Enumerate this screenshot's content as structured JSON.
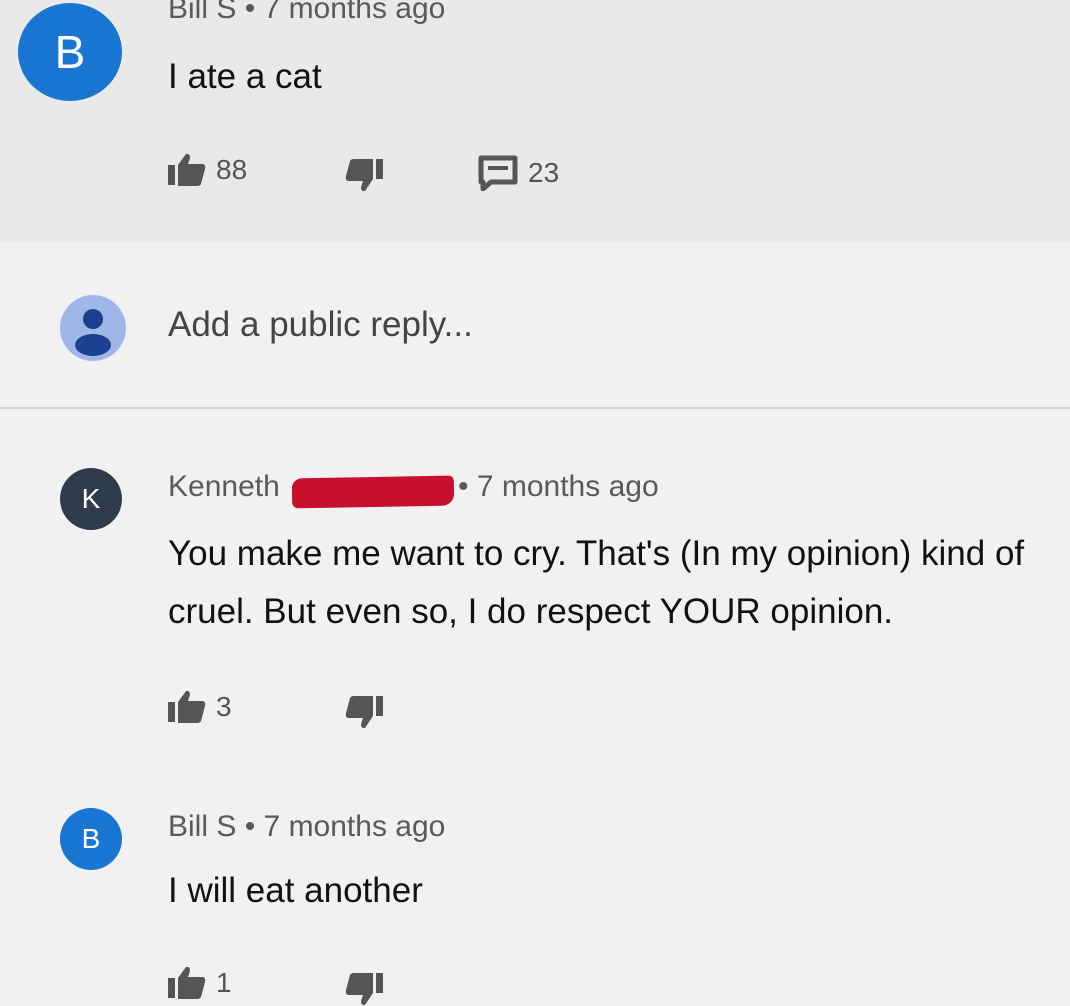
{
  "comments": [
    {
      "avatar_letter": "B",
      "author": "Bill S",
      "time": "7 months ago",
      "text": "I ate a cat",
      "likes": "88",
      "replies": "23"
    },
    {
      "avatar_letter": "K",
      "author": "Kenneth",
      "time": "7 months ago",
      "text": "You make me want to cry. That's (In my opinion) kind of cruel. But even so, I do respect YOUR opinion.",
      "likes": "3"
    },
    {
      "avatar_letter": "B",
      "author": "Bill S",
      "time": "7 months ago",
      "text": "I will eat another",
      "likes": "1"
    }
  ],
  "reply_box": {
    "placeholder": "Add a public reply..."
  },
  "colors": {
    "avatar_blue": "#1976d2",
    "avatar_dark": "#2f3a4a",
    "redaction": "#c8102e"
  }
}
